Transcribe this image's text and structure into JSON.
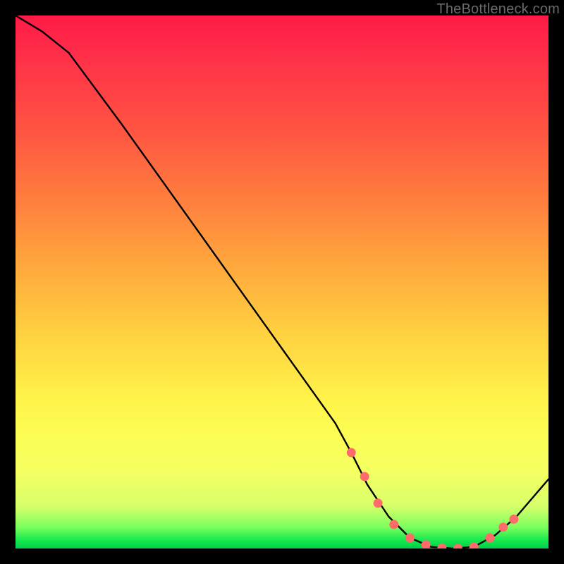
{
  "watermark": "TheBottleneck.com",
  "chart_data": {
    "type": "line",
    "title": "",
    "xlabel": "",
    "ylabel": "",
    "xlim": [
      0,
      100
    ],
    "ylim": [
      0,
      100
    ],
    "grid": false,
    "series": [
      {
        "name": "curve",
        "x": [
          0,
          5,
          10,
          20,
          30,
          40,
          50,
          60,
          63,
          66,
          70,
          74,
          78,
          82,
          86,
          90,
          94,
          100
        ],
        "values": [
          100,
          97,
          93,
          79.5,
          65.5,
          51.5,
          37.5,
          23.5,
          18,
          12,
          6,
          2,
          0.3,
          0,
          0.3,
          2.5,
          6,
          13
        ]
      }
    ],
    "markers": {
      "name": "dots",
      "color": "#ff6b6b",
      "shape": "circle",
      "x": [
        63,
        65.5,
        68,
        71,
        74,
        77,
        80,
        83,
        86,
        89,
        91.5,
        93.5
      ],
      "values": [
        18,
        13.5,
        8.5,
        4.5,
        2,
        0.7,
        0.1,
        0,
        0.3,
        2,
        4,
        5.5
      ]
    }
  }
}
